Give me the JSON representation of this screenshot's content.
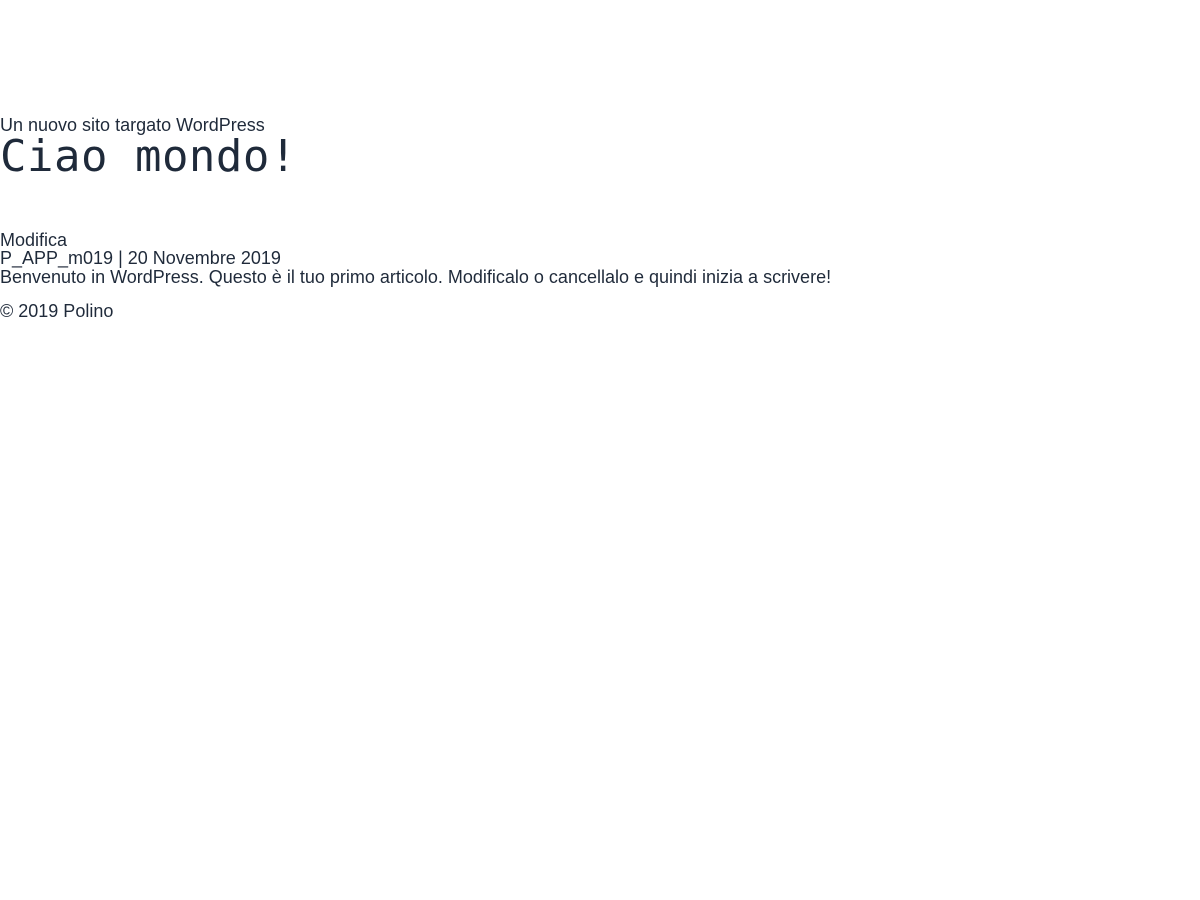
{
  "site": {
    "tagline": "Un nuovo sito targato WordPress"
  },
  "post": {
    "title": "Ciao mondo!",
    "edit_label": "Modifica",
    "author": "P_APP_m019",
    "separator": " | ",
    "date": "20 Novembre 2019",
    "content": "Benvenuto in WordPress. Questo è il tuo primo articolo. Modificalo o cancellalo e quindi inizia a scrivere!"
  },
  "footer": {
    "copyright": "© 2019 Polino"
  },
  "colors": {
    "text": "#1f2a3a",
    "background": "#ffffff"
  }
}
